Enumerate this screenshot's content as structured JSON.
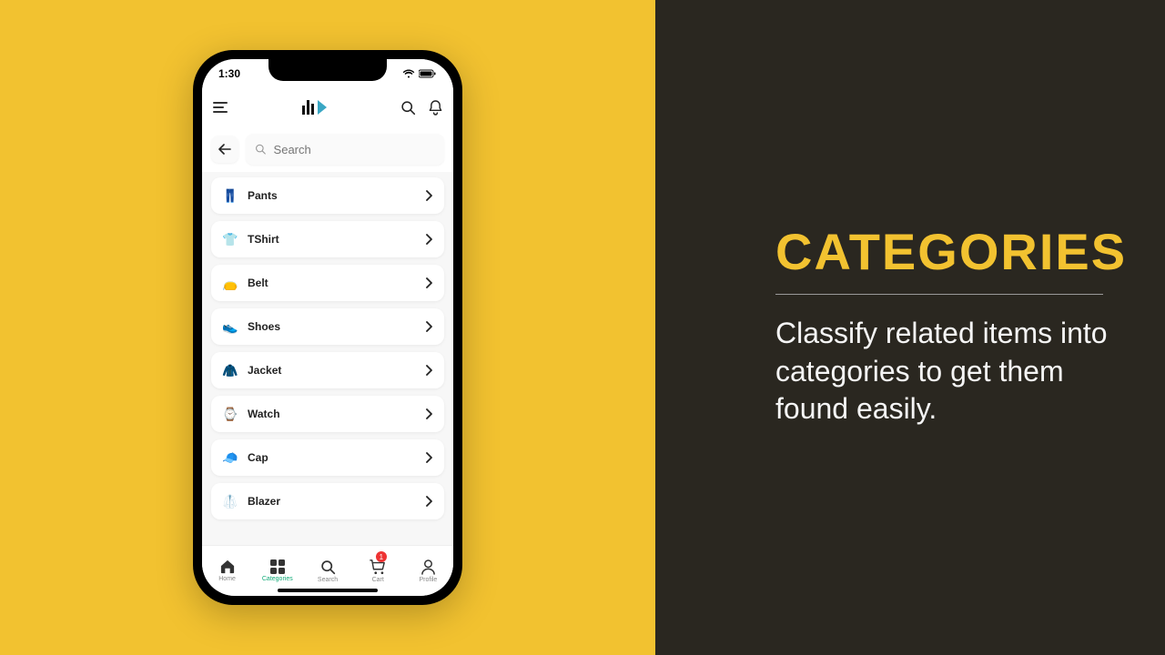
{
  "promo": {
    "heading": "CATEGORIES",
    "description": "Classify related items into categories to get them found easily."
  },
  "status": {
    "time": "1:30"
  },
  "search": {
    "placeholder": "Search"
  },
  "categories": [
    {
      "label": "Pants",
      "icon": "👖"
    },
    {
      "label": "TShirt",
      "icon": "👕"
    },
    {
      "label": "Belt",
      "icon": "👝"
    },
    {
      "label": "Shoes",
      "icon": "👟"
    },
    {
      "label": "Jacket",
      "icon": "🧥"
    },
    {
      "label": "Watch",
      "icon": "⌚"
    },
    {
      "label": "Cap",
      "icon": "🧢"
    },
    {
      "label": "Blazer",
      "icon": "🥼"
    }
  ],
  "nav": {
    "home": "Home",
    "categories": "Categories",
    "search": "Search",
    "cart": "Cart",
    "profile": "Profile",
    "cart_badge": "1"
  }
}
